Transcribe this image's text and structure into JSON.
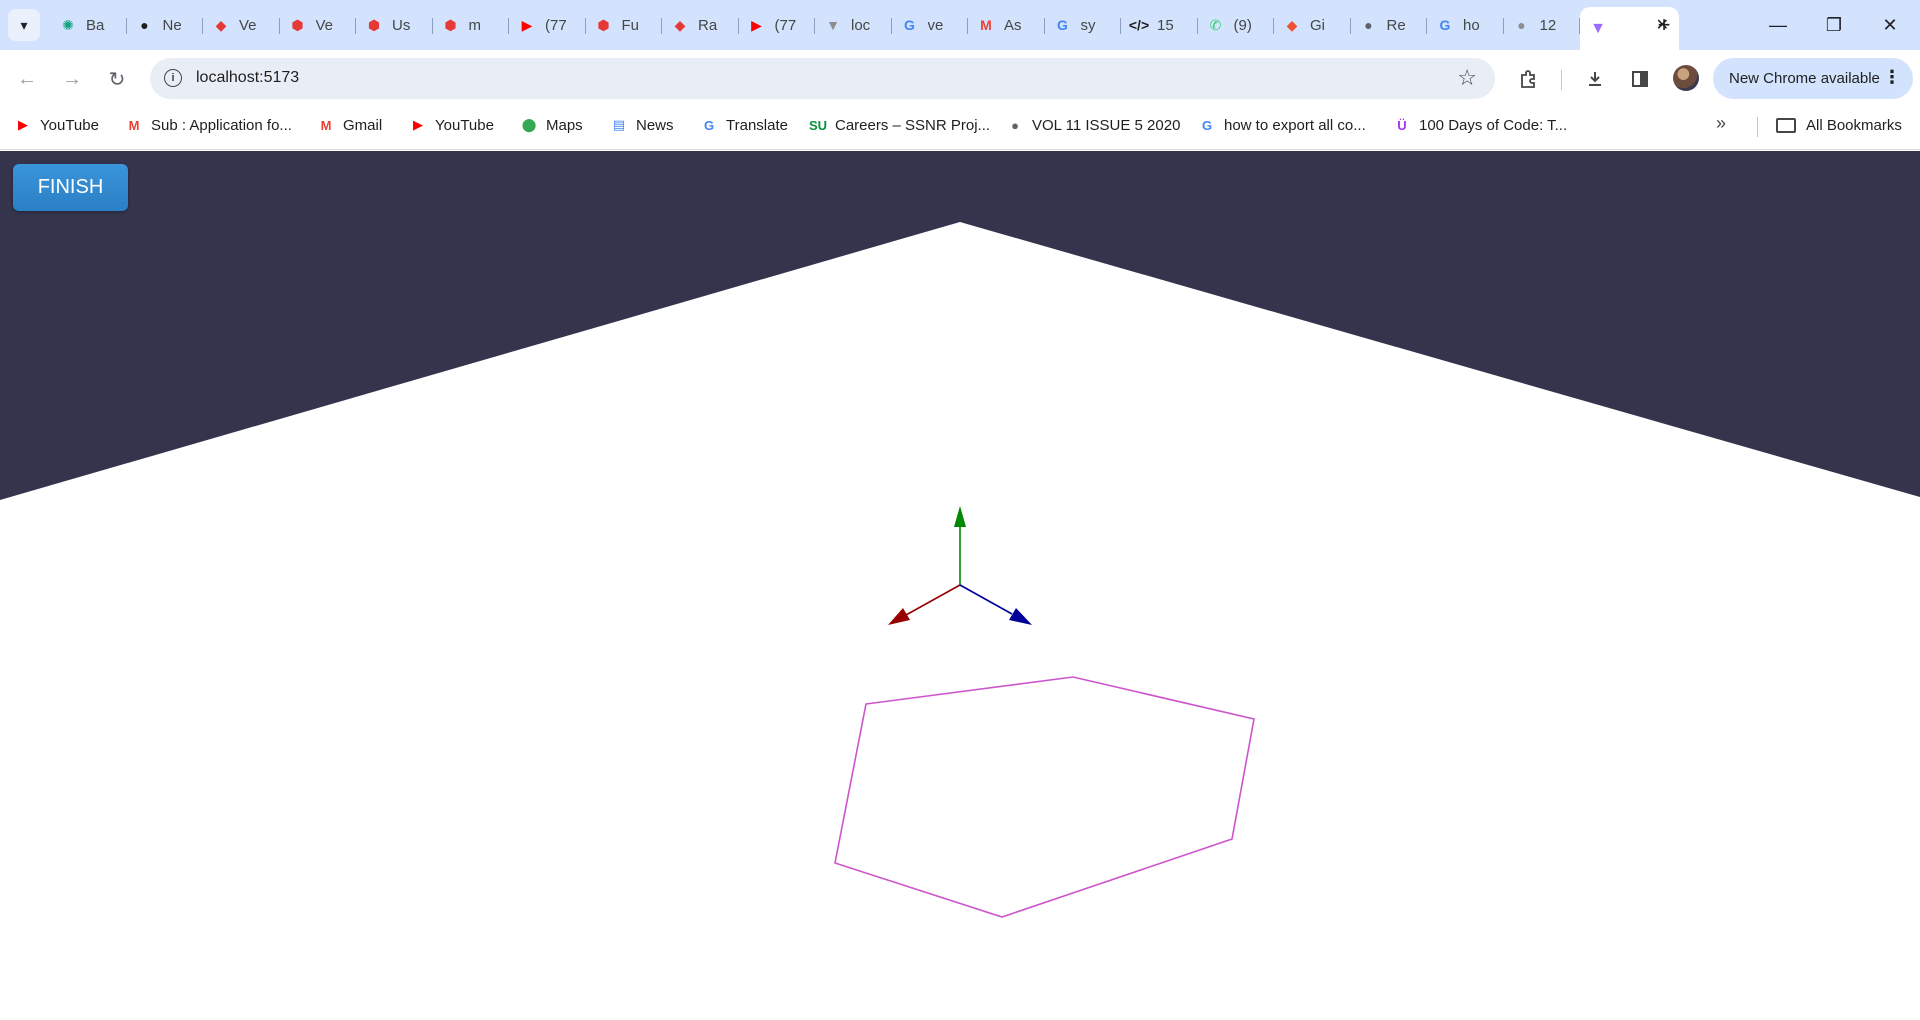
{
  "browser": {
    "tabs": [
      {
        "title": "Ba",
        "favicon": "chatgpt-icon",
        "color": "#10a37f"
      },
      {
        "title": "Ne",
        "favicon": "github-icon",
        "color": "#1f1f1f"
      },
      {
        "title": "Ve",
        "favicon": "vue-shield-icon",
        "color": "#e53935"
      },
      {
        "title": "Ve",
        "favicon": "hexagon-icon",
        "color": "#e53935"
      },
      {
        "title": "Us",
        "favicon": "hexagon-icon",
        "color": "#e53935"
      },
      {
        "title": "m",
        "favicon": "hexagon-icon",
        "color": "#e53935"
      },
      {
        "title": "(77",
        "favicon": "youtube-icon",
        "color": "#ff0000"
      },
      {
        "title": "Fu",
        "favicon": "hexagon-icon",
        "color": "#e53935"
      },
      {
        "title": "Ra",
        "favicon": "vue-shield-icon",
        "color": "#e53935"
      },
      {
        "title": "(77",
        "favicon": "youtube-icon",
        "color": "#ff0000"
      },
      {
        "title": "loc",
        "favicon": "vite-icon",
        "color": "#8d8d8d"
      },
      {
        "title": "ve",
        "favicon": "google-icon",
        "color": "#4285f4"
      },
      {
        "title": "As",
        "favicon": "gmail-icon",
        "color": "#ea4335"
      },
      {
        "title": "sy",
        "favicon": "google-icon",
        "color": "#4285f4"
      },
      {
        "title": "15",
        "favicon": "code-icon",
        "color": "#1f1f1f"
      },
      {
        "title": "(9)",
        "favicon": "whatsapp-icon",
        "color": "#25d366"
      },
      {
        "title": "Gi",
        "favicon": "git-icon",
        "color": "#f05033"
      },
      {
        "title": "Re",
        "favicon": "globe-icon",
        "color": "#5f6368"
      },
      {
        "title": "ho",
        "favicon": "google-icon",
        "color": "#4285f4"
      },
      {
        "title": "12",
        "favicon": "globe-icon",
        "color": "#8e8e8e"
      }
    ],
    "active_tab": {
      "title": "",
      "favicon": "vite-icon",
      "color": "#9c6bff"
    },
    "address": "localhost:5173",
    "update_chip": "New Chrome available",
    "bookmarks": [
      {
        "label": "YouTube",
        "icon": "youtube-icon",
        "color": "#ff0000"
      },
      {
        "label": "Sub : Application fo...",
        "icon": "gmail-icon",
        "color": "#ea4335"
      },
      {
        "label": "Gmail",
        "icon": "gmail-icon",
        "color": "#ea4335"
      },
      {
        "label": "YouTube",
        "icon": "youtube-icon",
        "color": "#ff0000"
      },
      {
        "label": "Maps",
        "icon": "maps-pin-icon",
        "color": "#34a853"
      },
      {
        "label": "News",
        "icon": "news-icon",
        "color": "#4285f4"
      },
      {
        "label": "Translate",
        "icon": "translate-icon",
        "color": "#4285f4"
      },
      {
        "label": "Careers – SSNR Proj...",
        "icon": "ssnr-icon",
        "color": "#0a8f3d"
      },
      {
        "label": "VOL 11 ISSUE 5 2020",
        "icon": "globe-icon",
        "color": "#5f6368"
      },
      {
        "label": "how to export all co...",
        "icon": "google-icon",
        "color": "#4285f4"
      },
      {
        "label": "100 Days of Code: T...",
        "icon": "udemy-icon",
        "color": "#a435f0"
      }
    ],
    "all_bookmarks": "All Bookmarks"
  },
  "app": {
    "finish_label": "FINISH",
    "colors": {
      "background_dark": "#34344d",
      "ground": "#ffffff",
      "polygon": "#cc55cc",
      "axis_x": "#990000",
      "axis_y": "#008800",
      "axis_z": "#000099"
    },
    "polygon_vertex_count": 6
  }
}
